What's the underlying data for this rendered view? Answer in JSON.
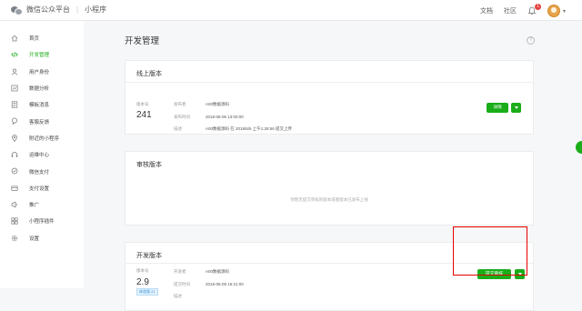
{
  "header": {
    "platform": "微信公众平台",
    "section": "小程序",
    "docs": "文档",
    "community": "社区",
    "notify_count": "1"
  },
  "sidebar": {
    "items": [
      {
        "label": "首页",
        "icon": "home-icon"
      },
      {
        "label": "开发管理",
        "icon": "code-icon",
        "active": true
      },
      {
        "label": "用户身份",
        "icon": "user-icon"
      },
      {
        "label": "数据分析",
        "icon": "chart-icon"
      },
      {
        "label": "模板消息",
        "icon": "template-icon"
      },
      {
        "label": "客服反馈",
        "icon": "service-icon"
      },
      {
        "label": "附近的小程序",
        "icon": "location-icon"
      },
      {
        "label": "运维中心",
        "icon": "ops-icon"
      },
      {
        "label": "微信支付",
        "icon": "pay-icon"
      },
      {
        "label": "支付设置",
        "icon": "pay-settings-icon"
      },
      {
        "label": "推广",
        "icon": "promote-icon"
      },
      {
        "label": "小程序插件",
        "icon": "plugin-icon"
      },
      {
        "label": "设置",
        "icon": "settings-icon"
      }
    ]
  },
  "main": {
    "title": "开发管理",
    "online": {
      "title": "线上版本",
      "version_label": "版本号",
      "version": "241",
      "publisher_key": "发布者",
      "publisher": "A00数据源码",
      "time_key": "发布时间",
      "time": "2018-06-05 13:00:00",
      "desc_key": "描述",
      "desc": "A00数据源码 在 2018/6/5 上午1:28:56 提交上传",
      "detail_button": "详情"
    },
    "review": {
      "title": "审核版本",
      "empty": "你暂无提交审核的版本或者版本已发布上线"
    },
    "dev": {
      "title": "开发版本",
      "version_label": "版本号",
      "version": "2.9",
      "tag": "体验版 21",
      "developer_key": "开发者",
      "developer": "A00数据源码",
      "time_key": "提交时间",
      "time": "2018-06-09 16:21:00",
      "desc_key": "描述",
      "submit_button": "提交审核"
    }
  },
  "colors": {
    "accent": "#1aad19",
    "highlight": "#e60000"
  }
}
